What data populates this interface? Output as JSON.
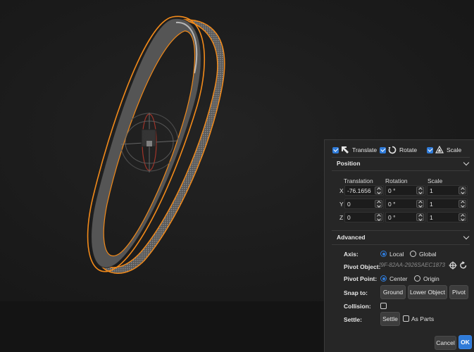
{
  "modes": {
    "translate": {
      "label": "Translate",
      "checked": true,
      "icon": "translate-arrow-icon"
    },
    "rotate": {
      "label": "Rotate",
      "checked": true,
      "icon": "rotate-icon"
    },
    "scale": {
      "label": "Scale",
      "checked": true,
      "icon": "scale-icon"
    }
  },
  "position": {
    "title": "Position",
    "columns": [
      "Translation",
      "Rotation",
      "Scale"
    ],
    "rows": [
      {
        "axis": "X",
        "translation": "-76.1656",
        "rotation": "0 °",
        "scale": "1"
      },
      {
        "axis": "Y",
        "translation": "0",
        "rotation": "0 °",
        "scale": "1"
      },
      {
        "axis": "Z",
        "translation": "0",
        "rotation": "0 °",
        "scale": "1"
      }
    ]
  },
  "advanced": {
    "title": "Advanced",
    "axis": {
      "label": "Axis:",
      "options": [
        "Local",
        "Global"
      ],
      "selected": "Local"
    },
    "pivot_object": {
      "label": "Pivot Object:",
      "value": "9F-82AA-2926SAEC1873})"
    },
    "pivot_point": {
      "label": "Pivot Point:",
      "options": [
        "Center",
        "Origin"
      ],
      "selected": "Center"
    },
    "snap_to": {
      "label": "Snap to:",
      "buttons": [
        "Ground",
        "Lower Object",
        "Pivot"
      ]
    },
    "collision": {
      "label": "Collision:",
      "checked": false
    },
    "settle": {
      "label": "Settle:",
      "button": "Settle",
      "as_parts_label": "As Parts",
      "as_parts_checked": false
    }
  },
  "footer": {
    "cancel": "Cancel",
    "ok": "OK"
  },
  "colors": {
    "accent": "#2f7bd9",
    "selection_outline": "#f28a1a",
    "panel_bg": "#262626"
  }
}
